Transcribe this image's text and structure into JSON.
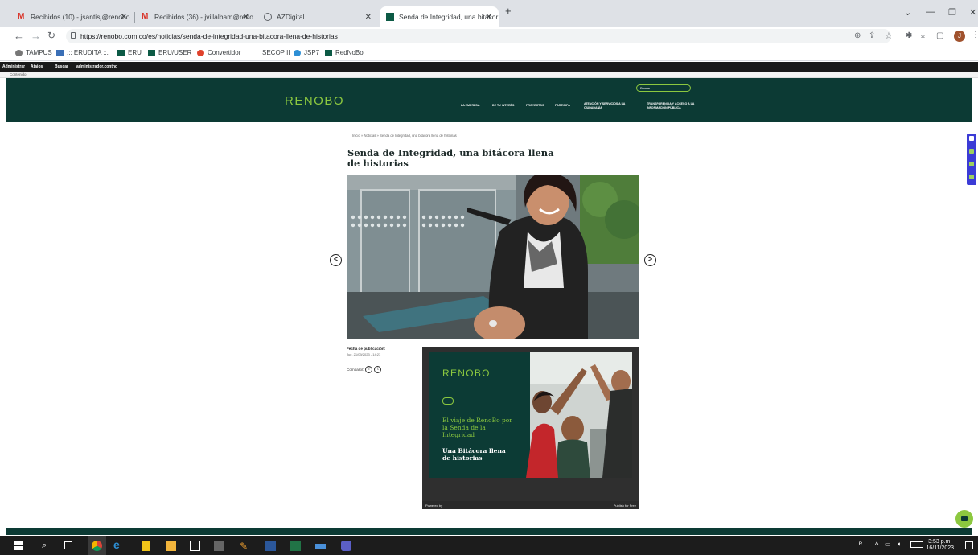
{
  "browser": {
    "tabs": [
      {
        "label": "Recibidos (10) - jsantisj@renobo"
      },
      {
        "label": "Recibidos (36) - jvillalbam@reno"
      },
      {
        "label": "AZDigital"
      },
      {
        "label": "Senda de Integridad, una bitácor"
      }
    ],
    "new_tab": "+",
    "url": "https://renobo.com.co/es/noticias/senda-de-integridad-una-bitacora-llena-de-historias",
    "bookmarks": [
      "TAMPUS",
      ".:: ERUDITA ::.",
      "ERU",
      "ERU/USER",
      "Convertidor",
      "SECOP II",
      "JSP7",
      "RedNoBo"
    ],
    "profile_initial": "J"
  },
  "admin_toolbar": {
    "items": [
      "Administrar",
      "Atajos",
      "Buscar",
      "administrador.contnd"
    ],
    "sub": "Contenido"
  },
  "site": {
    "logo": "RENOBO",
    "nav": [
      "LA EMPRESA",
      "DE TU INTERÉS",
      "PROYECTOS",
      "PARTICIPA",
      "ATENCIÓN Y SERVICIOS A LA CIUDADANÍA",
      "TRANSPARENCIA Y ACCESO A LA INFORMACIÓN PÚBLICA"
    ],
    "search_placeholder": "Buscar"
  },
  "article": {
    "breadcrumb": [
      "Inicio",
      "Noticias",
      "Senda de Integridad, una bitácora llena de historias"
    ],
    "breadcrumb_sep": "»",
    "title": "Senda de Integridad, una bitácora llena de historias",
    "pub_label": "Fecha de publicación:",
    "pub_date": "Jue, 21/09/2023 - 14:23",
    "share_label": "Compartir:"
  },
  "embed": {
    "logo": "RENOBO",
    "text1": "El viaje de RenoBo por la Senda de la Integridad",
    "text2": "Una Bitácora llena de historias",
    "powered_by": "Powered by",
    "publish_free": "Publish for Free"
  },
  "taskbar": {
    "time": "3:53 p.m.",
    "date": "16/11/2023"
  },
  "colors": {
    "brand_dark": "#0c3a34",
    "brand_green": "#8cc83f"
  }
}
